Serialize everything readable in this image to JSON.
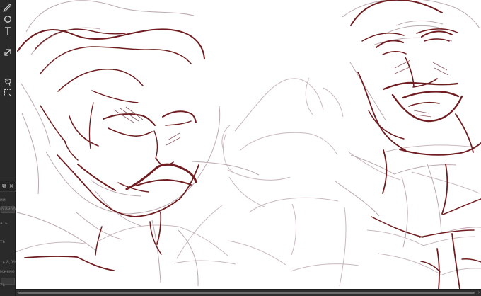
{
  "app": {
    "sidebar": {
      "labels": [
        "ий",
        "ю 8ибб",
        "ать",
        "ть",
        "ть 8,0%",
        "нжено в",
        "ть"
      ]
    },
    "scrollbar": {
      "left_arrow": "‹",
      "right_arrow": "›"
    },
    "colors": {
      "ui_bg": "#2b2b2b",
      "canvas_bg": "#ffffff",
      "sketch_dark": "#6f1d20",
      "sketch_light": "#b8a3a8"
    }
  }
}
